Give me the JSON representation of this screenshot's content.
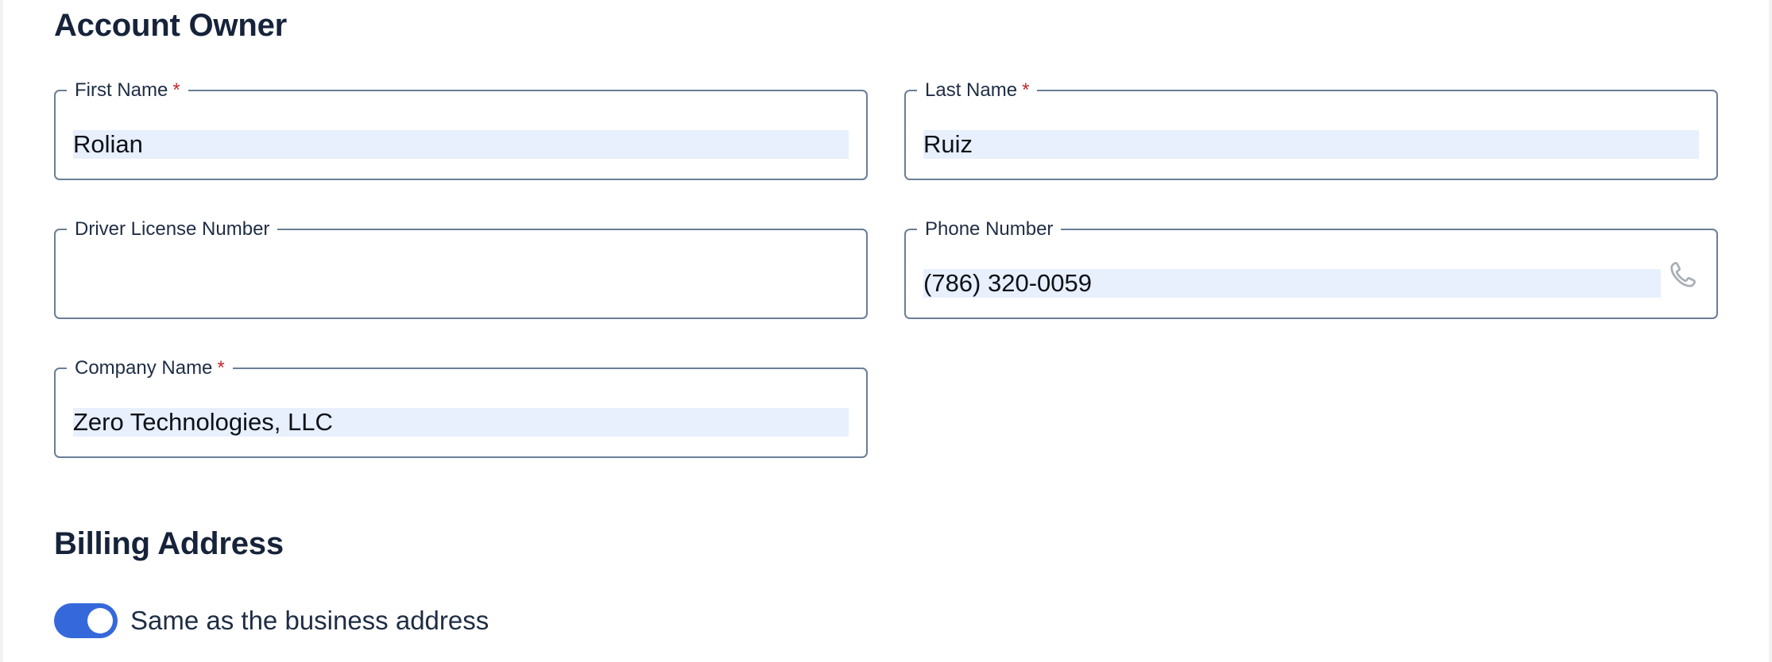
{
  "account_owner": {
    "title": "Account Owner",
    "required_mark": "*",
    "first_name": {
      "label": "First Name",
      "value": "Rolian",
      "required": true
    },
    "last_name": {
      "label": "Last Name",
      "value": "Ruiz",
      "required": true
    },
    "driver_license": {
      "label": "Driver License Number",
      "value": ""
    },
    "phone": {
      "label": "Phone Number",
      "value": "(786) 320-0059",
      "icon": "phone-icon"
    },
    "company": {
      "label": "Company Name",
      "value": "Zero Technologies, LLC",
      "required": true
    }
  },
  "billing_address": {
    "title": "Billing Address",
    "same_as_business": {
      "label": "Same as the business address",
      "checked": true
    }
  },
  "colors": {
    "accent": "#3569db",
    "required": "#c0282c",
    "field_border": "#6b7d97",
    "autofill_bg": "#e8effd",
    "heading": "#16233a"
  }
}
